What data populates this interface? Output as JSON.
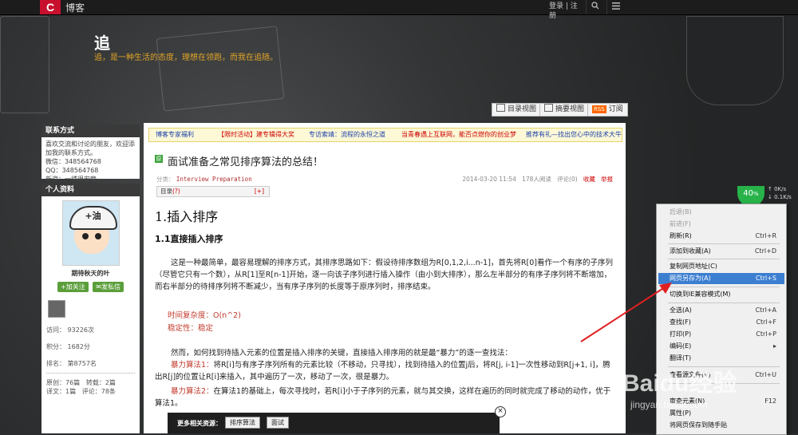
{
  "topbar": {
    "logo_letter": "C",
    "logo_text": "博客",
    "login": "登录 | 注册",
    "search_icon": "search-icon",
    "menu_icon": "menu-icon"
  },
  "banner": {
    "title": "追",
    "subtitle": "追，是一种生活的态度，理想在领跑，而我在追随。"
  },
  "view_buttons": {
    "catalog": "目录视图",
    "summary": "摘要视图",
    "rss_badge": "RSS",
    "subscribe": "订阅"
  },
  "sidebar": {
    "contact": {
      "heading": "联系方式",
      "lines": [
        "喜欢交流和讨论的朋友，欢迎添",
        "加我的联系方式。",
        "微信：348564768",
        "QQ：348564768",
        "新浪：一缕很安静"
      ]
    },
    "profile": {
      "heading": "个人资料",
      "avatar_text": "+油",
      "nickname": "期待秋天的叶",
      "follow": "加关注",
      "message": "发私信",
      "stats": [
        {
          "label": "访问：",
          "value": "93226次"
        },
        {
          "label": "积分：",
          "value": "1682分"
        },
        {
          "label": "排名：",
          "value": "第8757名"
        }
      ],
      "counts": [
        {
          "label": "原创：",
          "value": "76篇",
          "label2": "转载：",
          "value2": "2篇"
        },
        {
          "label": "译文：",
          "value": "1篇",
          "label2": "评论：",
          "value2": "78条"
        }
      ]
    }
  },
  "notice": {
    "items": [
      {
        "text": "博客专家福利",
        "color": "blue"
      },
      {
        "text": "【限时活动】建专辑得大奖",
        "color": "red"
      },
      {
        "text": "专访索靖：流程的永恒之道",
        "color": "blue"
      },
      {
        "text": "当青春遇上互联网，能否点燃你的创业梦",
        "color": "red"
      },
      {
        "text": "推荐有礼—找出您心中的技术大牛",
        "color": "blue"
      }
    ]
  },
  "article": {
    "original_badge": "原",
    "title": "面试准备之常见排序算法的总结！",
    "category_label": "分类：",
    "category": "Interview Preparation",
    "date": "2014-03-20 11:54",
    "reads": "178人阅读",
    "comments": "评论(0)",
    "favorite": "收藏",
    "report": "举报",
    "toc_label": "目录",
    "toc_open": "(?)",
    "toc_toggle": "[+]",
    "h1": "1.插入排序",
    "h2": "1.1直接插入排序",
    "p1": "这是一种最简单，最容易理解的排序方式，其排序思路如下：假设待排序数组为R[0,1,2,i...n-1]，首先将R[0]看作一个有序的子序列（尽管它只有一个数），从R[1]至R[n-1]开始，逐一向该子序列进行插入操作（由小到大排序），那么左半部分的有序子序列将不断增加，而右半部分的待排序列将不断减少，当有序子序列的长度等于原序列时，排序结束。",
    "time": "时间复杂度：O(n^2)",
    "stability": "稳定性：稳定",
    "p2": "然而，如何找到待插入元素的位置是插入排序的关键，直接插入排序用的就是最“暴力”的逐一查找法：",
    "algo1_label": "暴力算法1：",
    "algo1_text": "将R[i]与有序子序列所有的元素比较（不移动，只寻找），找到待插入的位置j后，将R[j, i-1]一次性移动到R[j+1, i]，腾出R[j]的位置让R[i]来插入，其中遍历了一次，移动了一次，很是暴力。",
    "algo2_label": "暴力算法2：",
    "algo2_text": "在算法1的基础上，每次寻找时，若R[i]小于子序列的元素，就与其交换，这样在遍历的同时就完成了移动的动作，优于算法1。"
  },
  "related": {
    "label": "更多相关资源：",
    "tags": [
      "排序算法",
      "面试"
    ],
    "close": "×"
  },
  "speed": {
    "percent": "40",
    "unit": "%",
    "up": "0K/s",
    "down": "0.1K/s"
  },
  "context_menu": {
    "items": [
      {
        "label": "后退(B)",
        "shortcut": "",
        "state": "dim"
      },
      {
        "label": "前进(F)",
        "shortcut": "",
        "state": "dim"
      },
      {
        "label": "刷新(R)",
        "shortcut": "Ctrl+R",
        "state": "normal"
      },
      {
        "label": "添加到收藏(A)",
        "shortcut": "Ctrl+D",
        "state": "normal"
      },
      {
        "label": "复制网页地址(C)",
        "shortcut": "",
        "state": "normal"
      },
      {
        "label": "网页另存为(A)",
        "shortcut": "Ctrl+S",
        "state": "highlight"
      },
      {
        "label": "切换到IE兼容模式(M)",
        "shortcut": "",
        "state": "normal"
      },
      {
        "label": "全选(A)",
        "shortcut": "Ctrl+A",
        "state": "normal"
      },
      {
        "label": "查找(F)",
        "shortcut": "Ctrl+F",
        "state": "normal"
      },
      {
        "label": "打印(P)",
        "shortcut": "Ctrl+P",
        "state": "normal"
      },
      {
        "label": "编码(E)",
        "shortcut": "▸",
        "state": "normal"
      },
      {
        "label": "翻译(T)",
        "shortcut": "",
        "state": "normal"
      },
      {
        "label": "查看源文件(V)",
        "shortcut": "Ctrl+U",
        "state": "normal"
      },
      {
        "label": "审查元素(N)",
        "shortcut": "F12",
        "state": "normal"
      },
      {
        "label": "属性(P)",
        "shortcut": "",
        "state": "normal"
      },
      {
        "label": "将网页保存到随手贴",
        "shortcut": "",
        "state": "normal"
      }
    ]
  },
  "watermark": {
    "brand": "Baidu经验",
    "url": "jingyan.baidu.com"
  },
  "colors": {
    "accent_red": "#c8102e",
    "menu_highlight": "#3c7fd1",
    "speed_green": "#28b34a",
    "subtitle_orange": "#e0a428"
  }
}
